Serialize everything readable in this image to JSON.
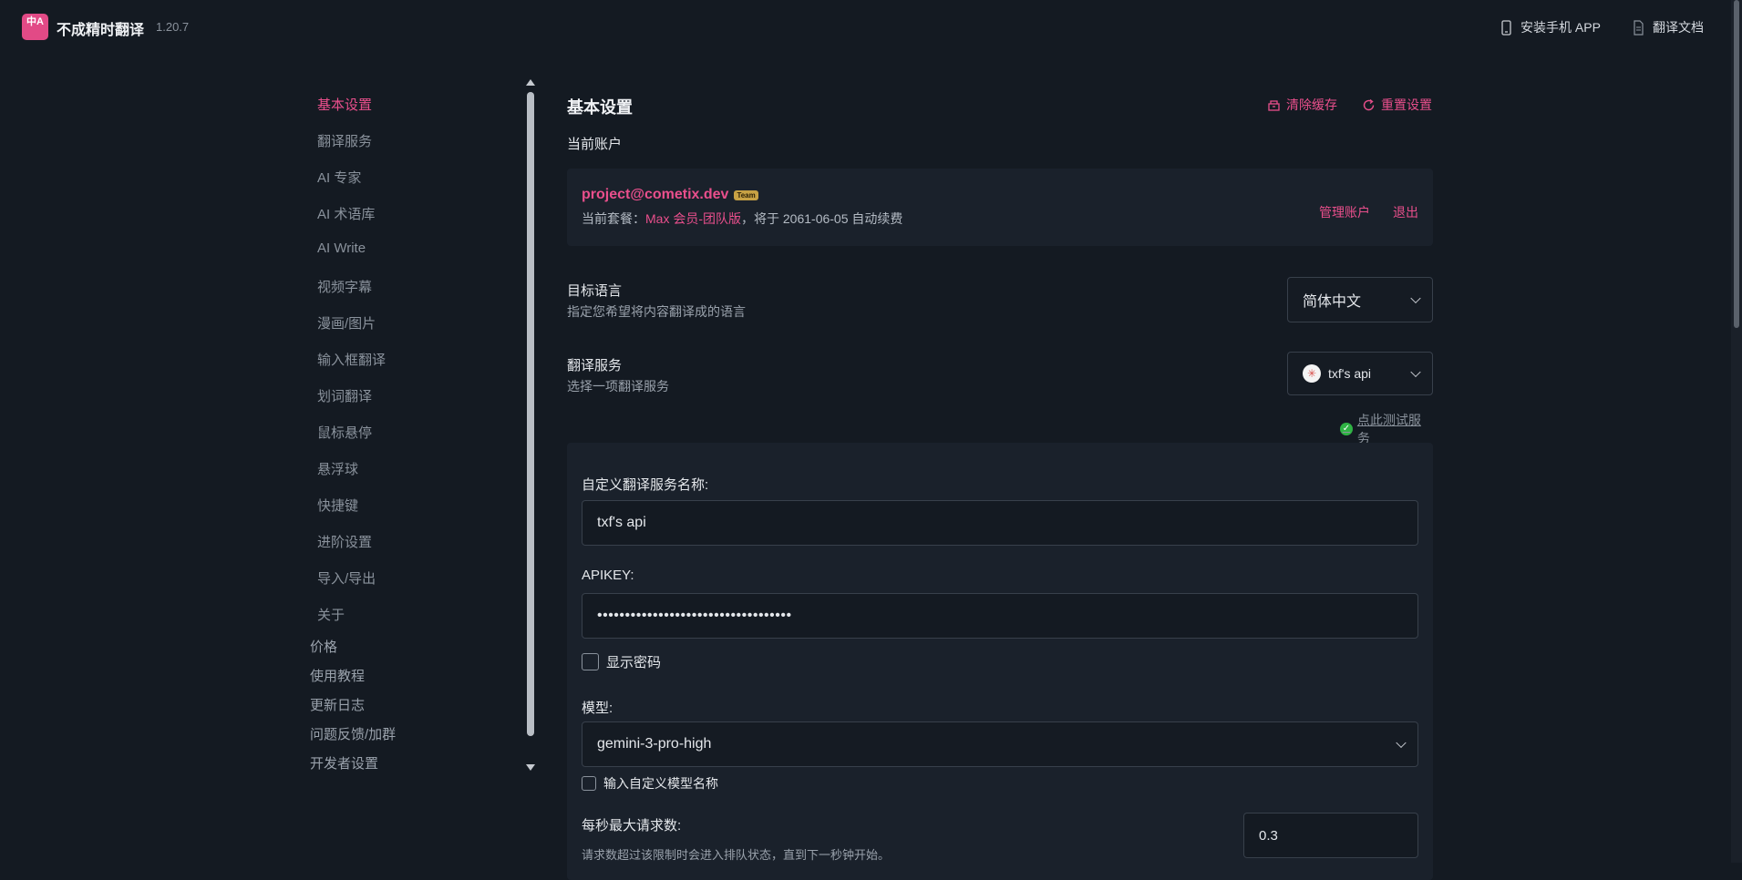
{
  "app": {
    "logo_text": "中A",
    "name": "不成精时翻译",
    "version": "1.20.7"
  },
  "topbar": {
    "install_app": "安装手机 APP",
    "docs": "翻译文档"
  },
  "sidebar": {
    "items": [
      {
        "label": "基本设置"
      },
      {
        "label": "翻译服务"
      },
      {
        "label": "AI 专家"
      },
      {
        "label": "AI 术语库"
      },
      {
        "label": "AI Write"
      },
      {
        "label": "视频字幕"
      },
      {
        "label": "漫画/图片"
      },
      {
        "label": "输入框翻译"
      },
      {
        "label": "划词翻译"
      },
      {
        "label": "鼠标悬停"
      },
      {
        "label": "悬浮球"
      },
      {
        "label": "快捷键"
      },
      {
        "label": "进阶设置"
      },
      {
        "label": "导入/导出"
      },
      {
        "label": "关于"
      }
    ],
    "extra": [
      {
        "label": "价格"
      },
      {
        "label": "使用教程"
      },
      {
        "label": "更新日志"
      },
      {
        "label": "问题反馈/加群"
      },
      {
        "label": "开发者设置"
      }
    ]
  },
  "main": {
    "title": "基本设置",
    "clear_cache": "清除缓存",
    "reset": "重置设置",
    "account_label": "当前账户",
    "account": {
      "email": "project@cometix.dev",
      "badge": "Team",
      "plan_prefix": "当前套餐：",
      "plan_name": "Max 会员-团队版",
      "plan_suffix": "，将于 2061-06-05 自动续费",
      "manage": "管理账户",
      "logout": "退出"
    },
    "target_lang": {
      "label": "目标语言",
      "hint": "指定您希望将内容翻译成的语言",
      "value": "简体中文"
    },
    "service": {
      "label": "翻译服务",
      "hint": "选择一项翻译服务",
      "value": "txf's api",
      "test": "点此测试服务"
    },
    "custom": {
      "name_label": "自定义翻译服务名称:",
      "name_value": "txf's api",
      "apikey_label": "APIKEY:",
      "apikey_value": "•••••••••••••••••••••••••••••••••••",
      "show_password": "显示密码",
      "model_label": "模型:",
      "model_value": "gemini-3-pro-high",
      "custom_model": "输入自定义模型名称",
      "rps_label": "每秒最大请求数:",
      "rps_hint": "请求数超过该限制时会进入排队状态，直到下一秒钟开始。",
      "rps_value": "0.3"
    }
  },
  "colors": {
    "accent": "#e94f8c",
    "background": "#141a22",
    "panel": "#1a212b",
    "success": "#2fb344"
  }
}
